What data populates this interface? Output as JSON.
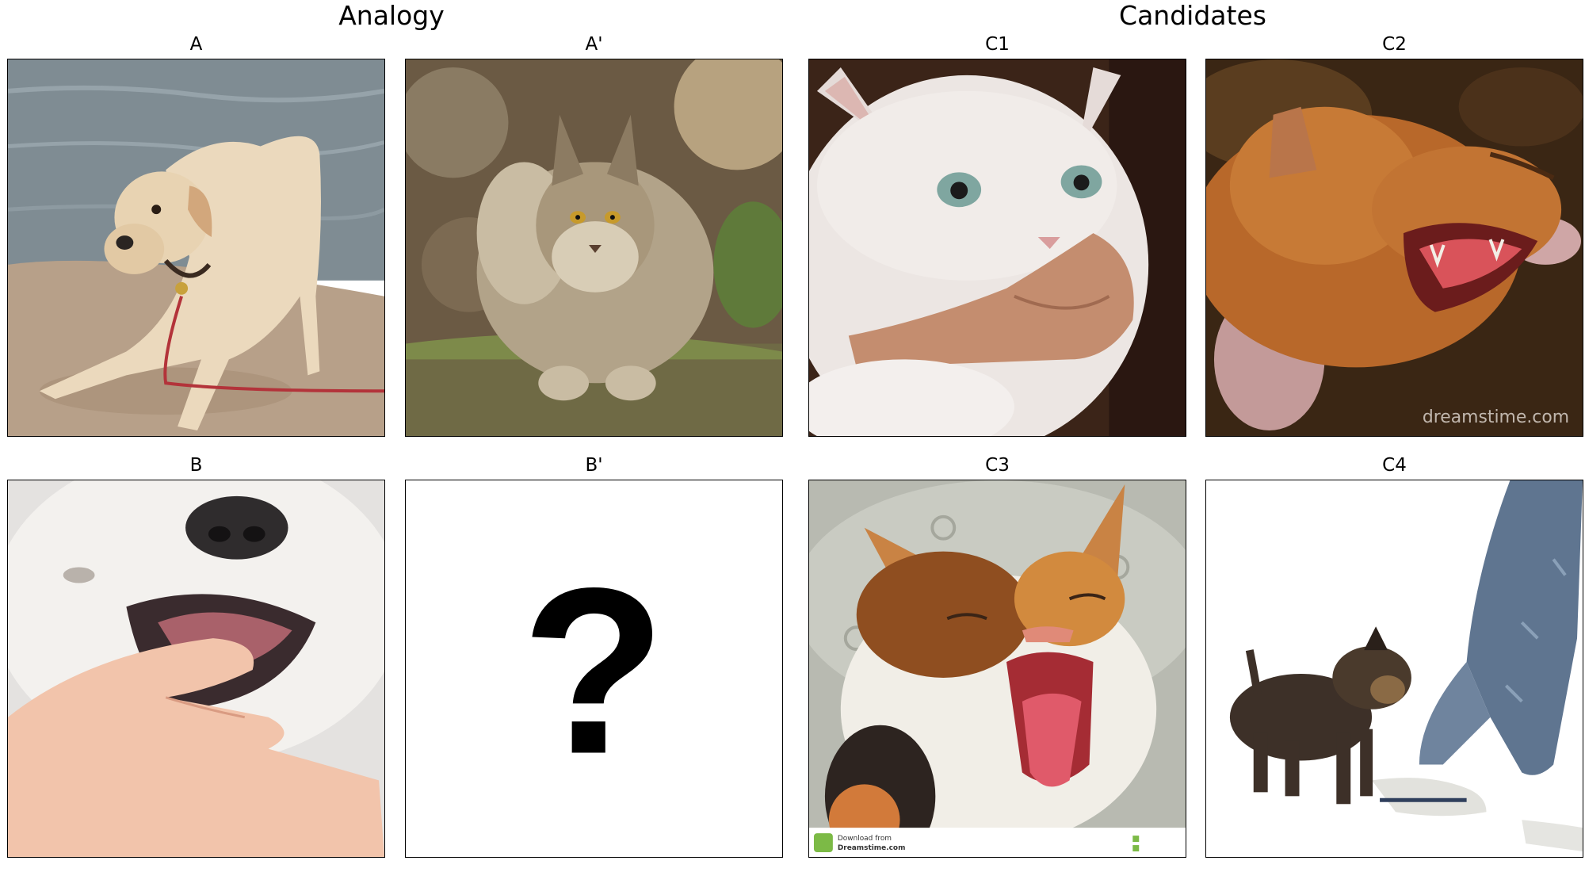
{
  "headings": {
    "analogy": "Analogy",
    "candidates": "Candidates"
  },
  "panels": {
    "a": {
      "label": "A"
    },
    "a_prime": {
      "label": "A'"
    },
    "b": {
      "label": "B"
    },
    "b_prime": {
      "label": "B'",
      "placeholder": "?"
    },
    "c1": {
      "label": "C1"
    },
    "c2": {
      "label": "C2",
      "watermark": "dreamstime.com"
    },
    "c3": {
      "label": "C3",
      "footer_text": "Download from",
      "footer_site": "Dreamstime.com"
    },
    "c4": {
      "label": "C4"
    }
  }
}
